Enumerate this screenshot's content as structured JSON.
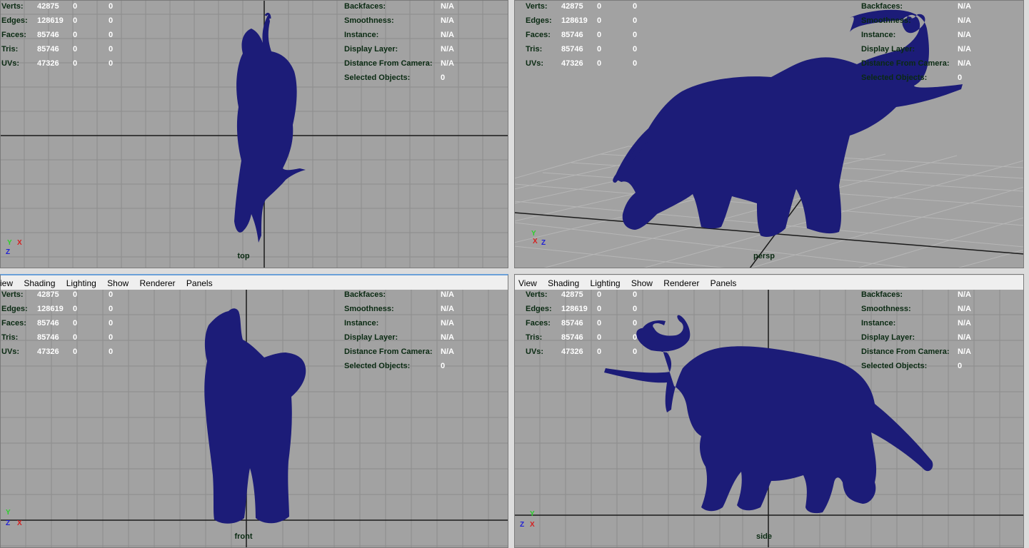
{
  "menu": [
    "View",
    "Shading",
    "Lighting",
    "Show",
    "Renderer",
    "Panels"
  ],
  "menu_right": [
    "View",
    "Shading",
    "Lighting",
    "Show",
    "Renderer",
    "Panels"
  ],
  "menu_left_first": "iew",
  "hud_left": [
    {
      "label": "Verts:",
      "a": "42875",
      "b": "0",
      "c": "0"
    },
    {
      "label": "Edges:",
      "a": "128619",
      "b": "0",
      "c": "0"
    },
    {
      "label": "Faces:",
      "a": "85746",
      "b": "0",
      "c": "0"
    },
    {
      "label": "Tris:",
      "a": "85746",
      "b": "0",
      "c": "0"
    },
    {
      "label": "UVs:",
      "a": "47326",
      "b": "0",
      "c": "0"
    }
  ],
  "hud_right": [
    {
      "label": "Backfaces:",
      "value": "N/A"
    },
    {
      "label": "Smoothness:",
      "value": "N/A"
    },
    {
      "label": "Instance:",
      "value": "N/A"
    },
    {
      "label": "Display Layer:",
      "value": "N/A"
    },
    {
      "label": "Distance From Camera:",
      "value": "N/A"
    },
    {
      "label": "Selected Objects:",
      "value": "0"
    }
  ],
  "cameras": {
    "top": "top",
    "persp": "persp",
    "front": "front",
    "side": "side"
  },
  "axes": {
    "top": [
      "Y",
      "X",
      "Z"
    ],
    "persp": [
      "Y",
      "X",
      "Z"
    ],
    "front": [
      "Y",
      "Z",
      "X"
    ],
    "side": [
      "Y",
      "Z",
      "X"
    ]
  },
  "colors": {
    "viewport_bg": "#a2a2a2",
    "grid": "#8c8c8c",
    "grid_axis": "#1a1a1a",
    "mesh": "#1c1c78",
    "hud_text": "#0a2a12"
  }
}
